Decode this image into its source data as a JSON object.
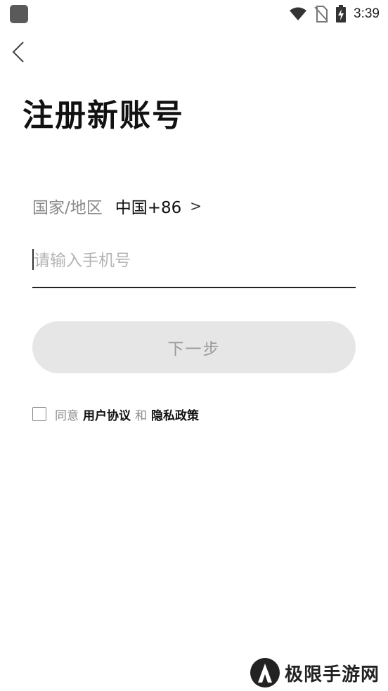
{
  "status_bar": {
    "time": "3:39",
    "icons": [
      "app-notification-icon",
      "wifi-icon",
      "no-sim-icon",
      "battery-charging-icon"
    ]
  },
  "header": {
    "back_icon": "chevron-left-icon",
    "title": "注册新账号"
  },
  "form": {
    "region_label": "国家/地区",
    "region_value": "中国+86",
    "region_chevron": ">",
    "phone_placeholder": "请输入手机号",
    "phone_value": "",
    "next_label": "下一步"
  },
  "agreement": {
    "checked": false,
    "agree_text": "同意",
    "user_agreement": "用户协议",
    "and_text": "和",
    "privacy_policy": "隐私政策"
  },
  "watermark": {
    "text": "极限手游网",
    "icon": "jixian-logo-icon"
  },
  "colors": {
    "button_bg": "#e6e6e6",
    "button_text": "#9a9a9a",
    "label_gray": "#8a8a8a"
  }
}
